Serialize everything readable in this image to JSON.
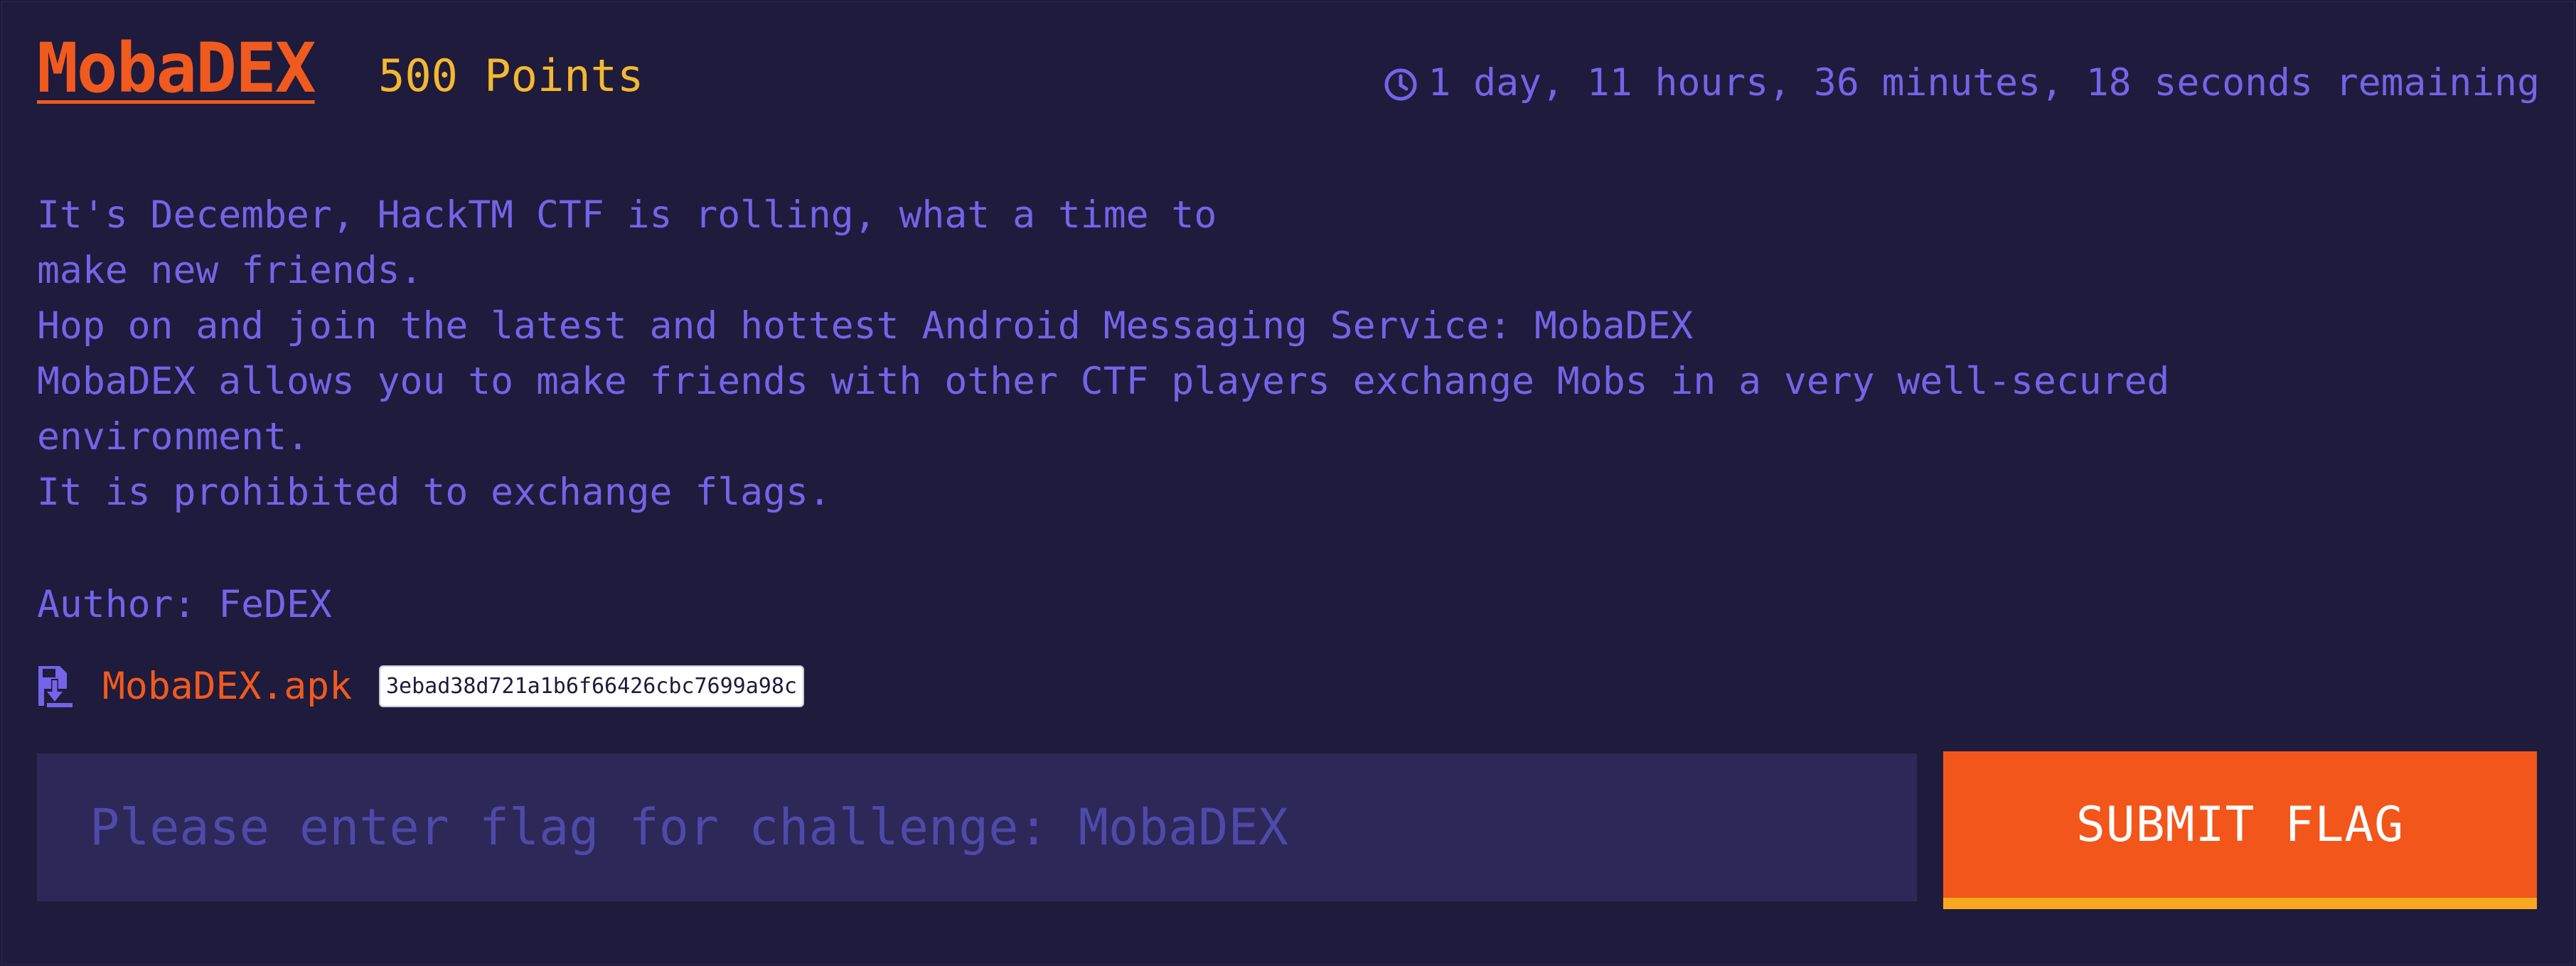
{
  "challenge": {
    "name": "MobaDEX",
    "points": "500 Points",
    "time_remaining": "1 day, 11 hours, 36 minutes, 18 seconds remaining"
  },
  "description": {
    "lines": [
      "It's December, HackTM CTF is rolling, what a time to",
      "make new friends.",
      "Hop on and join the latest and hottest Android Messaging Service: MobaDEX",
      "MobaDEX allows you to make friends with other CTF players exchange Mobs in a very well-secured",
      "environment.",
      "It is prohibited to exchange flags."
    ],
    "author": "Author: FeDEX"
  },
  "attachment": {
    "filename": "MobaDEX.apk",
    "hash": "3ebad38d721a1b6f66426cbc7699a98c",
    "icon": "download-file-icon"
  },
  "flag_form": {
    "value": "",
    "placeholder": "Please enter flag for challenge: MobaDEX",
    "submit_label": "SUBMIT FLAG"
  },
  "colors": {
    "background": "#1f1b3c",
    "accent_orange": "#f15a1f",
    "points_yellow": "#f4b830",
    "text_purple": "#7364e8",
    "input_background": "#2c2858",
    "button_border": "#f7a81e"
  },
  "icons": {
    "timer": "clock-icon"
  }
}
